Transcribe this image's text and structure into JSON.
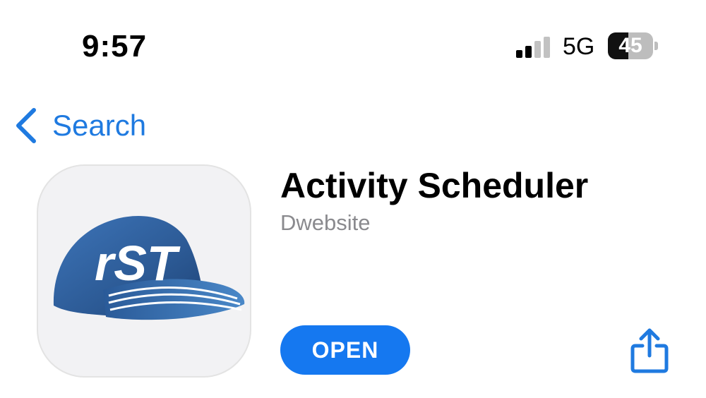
{
  "status_bar": {
    "time": "9:57",
    "network": "5G",
    "battery_level": "45",
    "battery_fraction": 0.45,
    "signal_bars_active": 2,
    "signal_bars_total": 4
  },
  "nav": {
    "back_label": "Search"
  },
  "app": {
    "title": "Activity Scheduler",
    "developer": "Dwebsite",
    "icon_text": "rST",
    "open_label": "OPEN"
  },
  "colors": {
    "accent": "#1f7ae0",
    "open_button": "#1578f0",
    "cap_blue": "#2f5f9c"
  },
  "icons": {
    "back": "chevron-left-icon",
    "share": "share-icon",
    "signal": "cellular-signal-icon",
    "battery": "battery-icon"
  }
}
